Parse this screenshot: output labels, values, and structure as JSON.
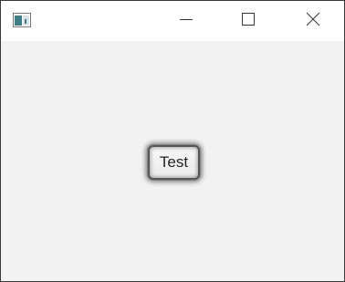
{
  "window": {
    "icon": "java-app-icon",
    "controls": {
      "minimize_icon": "minimize-icon",
      "maximize_icon": "maximize-icon",
      "close_icon": "close-icon"
    }
  },
  "main": {
    "button_label": "Test"
  }
}
